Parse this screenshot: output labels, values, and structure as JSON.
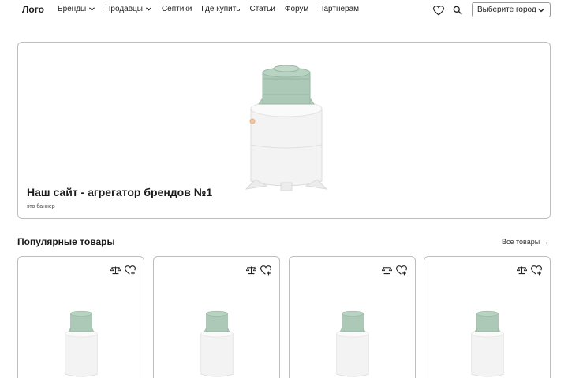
{
  "header": {
    "logo": "Лого",
    "nav": [
      {
        "label": "Бренды",
        "dropdown": true
      },
      {
        "label": "Продавцы",
        "dropdown": true
      },
      {
        "label": "Септики",
        "dropdown": false
      },
      {
        "label": "Где купить",
        "dropdown": false
      },
      {
        "label": "Статьи",
        "dropdown": false
      },
      {
        "label": "Форум",
        "dropdown": false
      },
      {
        "label": "Партнерам",
        "dropdown": false
      }
    ],
    "icons": [
      "heart-icon",
      "search-icon"
    ],
    "city_select": {
      "value": "Выберите город",
      "icon": "chevron-down-icon"
    }
  },
  "banner": {
    "title": "Наш сайт - агрегатор брендов №1",
    "subtitle": "это баннер",
    "image": "septic-tank-product-image"
  },
  "popular": {
    "title": "Популярные товары",
    "all_link": "Все товары →",
    "cards": [
      {
        "image": "septic-tank-product-image",
        "actions": [
          "compare-scale-icon",
          "add-to-favorites-icon"
        ]
      },
      {
        "image": "septic-tank-product-image",
        "actions": [
          "compare-scale-icon",
          "add-to-favorites-icon"
        ]
      },
      {
        "image": "septic-tank-product-image",
        "actions": [
          "compare-scale-icon",
          "add-to-favorites-icon"
        ]
      },
      {
        "image": "septic-tank-product-image",
        "actions": [
          "compare-scale-icon",
          "add-to-favorites-icon"
        ]
      }
    ]
  },
  "colors": {
    "text": "#1a1a1a",
    "border": "#bdbdbd",
    "tank_green": "#a8c8b4",
    "tank_white": "#f4f4f4"
  }
}
